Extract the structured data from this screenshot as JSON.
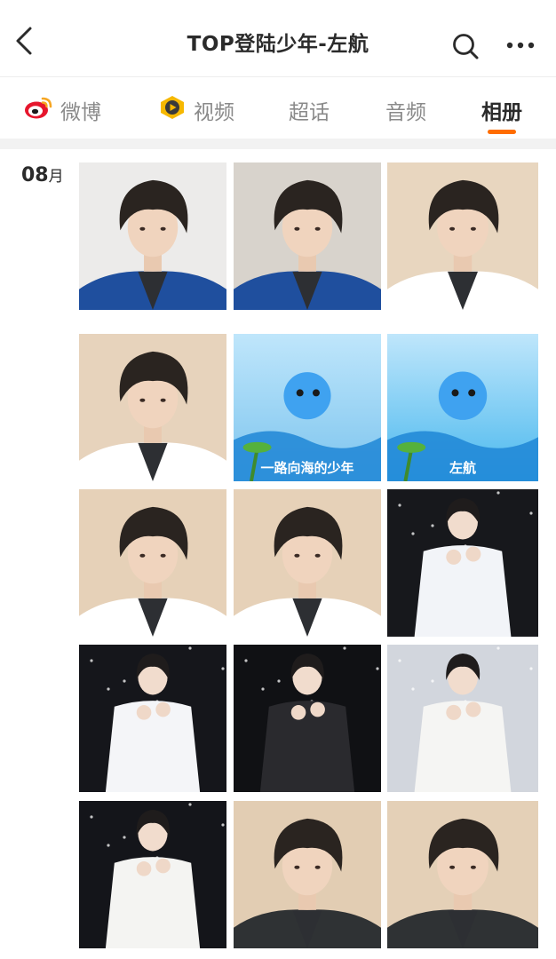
{
  "header": {
    "title": "TOP登陆少年-左航"
  },
  "tabs": [
    {
      "label": "微博",
      "icon": "weibo-logo-icon",
      "active": false
    },
    {
      "label": "视频",
      "icon": "video-play-icon",
      "active": false
    },
    {
      "label": "超话",
      "active": false
    },
    {
      "label": "音频",
      "active": false
    },
    {
      "label": "相册",
      "active": true
    }
  ],
  "album": {
    "month_number": "08",
    "month_unit": "月",
    "photos": [
      {
        "type": "selfie",
        "bg": "#ecebea",
        "clothes": "#1f4f9e"
      },
      {
        "type": "selfie",
        "bg": "#d8d3cc",
        "clothes": "#1f4f9e"
      },
      {
        "type": "selfie",
        "bg": "#e8d6bf",
        "clothes": "#ffffff"
      },
      {
        "type": "selfie",
        "bg": "#e7d3bc",
        "clothes": "#ffffff"
      },
      {
        "type": "poster",
        "bg": "#7cc4ee",
        "poster_text": "一路向海的少年"
      },
      {
        "type": "poster",
        "bg": "#49b8ee",
        "poster_text": "左航"
      },
      {
        "type": "selfie",
        "bg": "#e6d1b8",
        "clothes": "#ffffff"
      },
      {
        "type": "selfie",
        "bg": "#e6d1b8",
        "clothes": "#ffffff"
      },
      {
        "type": "stage",
        "bg": "#17181c",
        "clothes": "#f2f4f8"
      },
      {
        "type": "stage",
        "bg": "#15161b",
        "clothes": "#f4f5f8"
      },
      {
        "type": "stage",
        "bg": "#101114",
        "clothes": "#2a2a2e"
      },
      {
        "type": "stage",
        "bg": "#d2d6dd",
        "clothes": "#f5f5f3"
      },
      {
        "type": "stage",
        "bg": "#14151a",
        "clothes": "#f4f4f2"
      },
      {
        "type": "selfie",
        "bg": "#e2cdb3",
        "clothes": "#2f3234"
      },
      {
        "type": "selfie",
        "bg": "#e4d0b7",
        "clothes": "#2f3234"
      }
    ]
  },
  "colors": {
    "accent": "#ff6d00",
    "active_tab": "#2b2b2b",
    "inactive_tab": "#8a8a8a",
    "divider": "#f2f2f2"
  }
}
